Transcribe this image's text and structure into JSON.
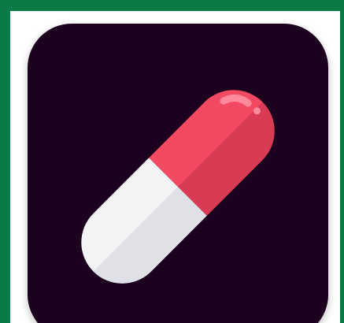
{
  "icon": {
    "name": "pill-capsule-icon",
    "colors": {
      "frame": "#0b7a45",
      "tile_background": "#1d0220",
      "capsule_red": "#f24a63",
      "capsule_red_dark": "#d93a54",
      "capsule_white": "#f3f4f6",
      "capsule_white_dark": "#dfe1e6",
      "highlight": "#ff8a9b"
    }
  }
}
